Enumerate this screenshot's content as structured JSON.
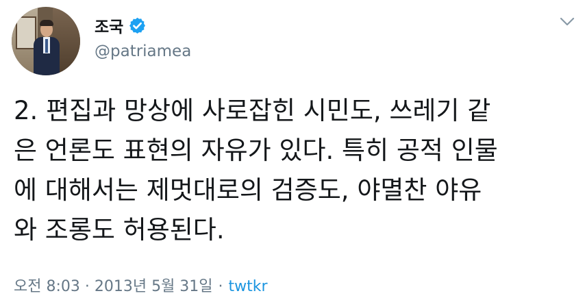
{
  "user": {
    "display_name": "조국",
    "handle": "@patriamea",
    "verified_icon": "verified-badge-icon"
  },
  "tweet": {
    "lines": [
      "2. 편집과 망상에 사로잡힌 시민도, 쓰레기 같",
      "은 언론도 표현의 자유가 있다. 특히 공적 인물",
      "에 대해서는 제멋대로의 검증도, 야멸찬 야유",
      "와 조롱도 허용된다."
    ],
    "timestamp": "오전 8:03 · 2013년 5월 31일",
    "separator": "·",
    "source": "twtkr"
  },
  "icons": {
    "more": "chevron-down-icon"
  },
  "colors": {
    "verified_blue": "#1da1f2",
    "link_blue": "#1b95e0",
    "muted_gray": "#657786",
    "text": "#14171a"
  }
}
